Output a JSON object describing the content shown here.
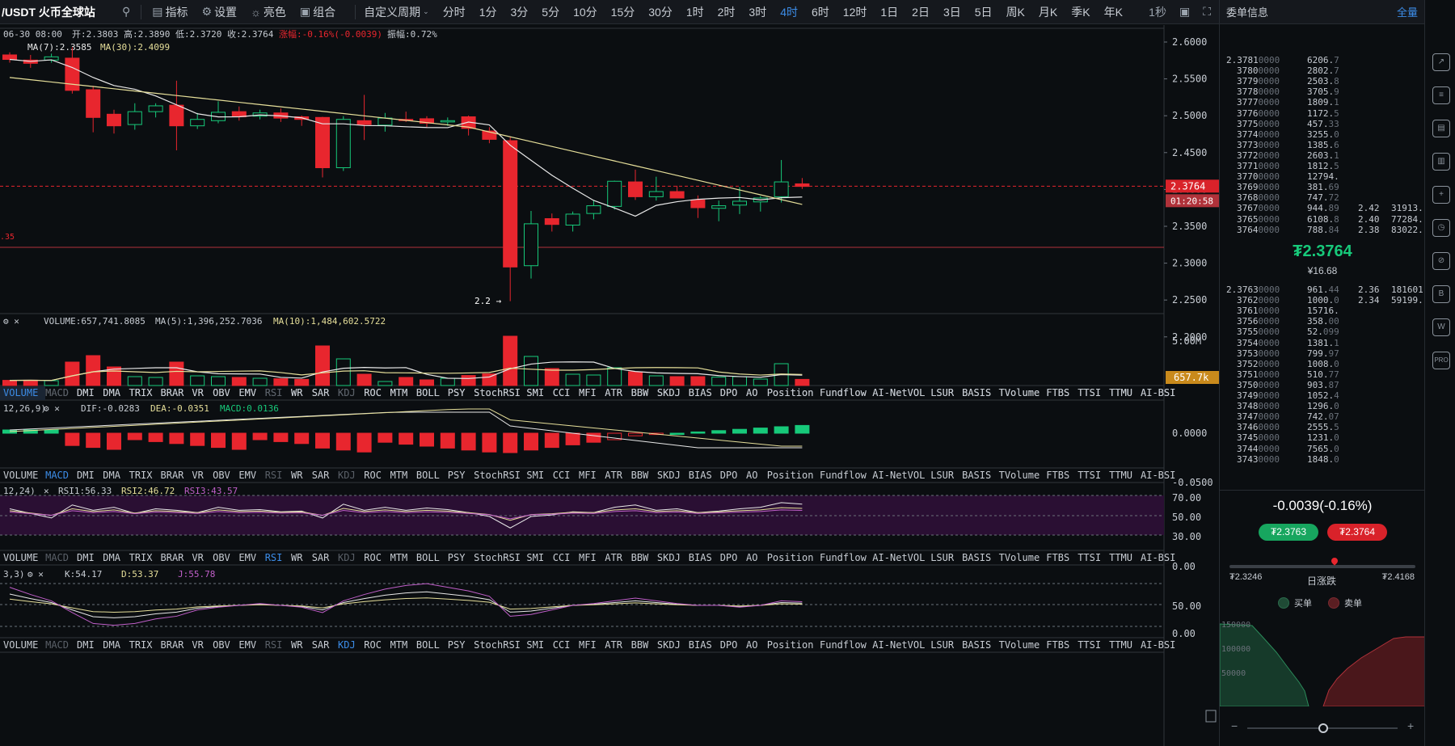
{
  "symbol": "/USDT 火币全球站",
  "toolbar": {
    "search_icon": "search-icon",
    "indicator": "指标",
    "settings": "设置",
    "theme": "亮色",
    "combo": "组合",
    "custom_period": "自定义周期"
  },
  "intervals": [
    "分时",
    "1分",
    "3分",
    "5分",
    "10分",
    "15分",
    "30分",
    "1时",
    "2时",
    "3时",
    "4时",
    "6时",
    "12时",
    "1日",
    "2日",
    "3日",
    "5日",
    "周K",
    "月K",
    "季K",
    "年K"
  ],
  "active_interval": "4时",
  "topbar_right": {
    "refresh": "1秒"
  },
  "info_line": {
    "date": "06-30 08:00",
    "open": "开:2.3803",
    "high": "高:2.3890",
    "low": "低:2.3720",
    "close": "收:2.3764",
    "change": "涨幅:-0.16%(-0.0039)",
    "amplitude": "振幅:0.72%"
  },
  "ma_line": {
    "ma7": "MA(7):2.3585",
    "ma30": "MA(30):2.4099"
  },
  "price_axis": [
    "2.6000",
    "2.5500",
    "2.5000",
    "2.4500",
    "2.4000",
    "2.3500",
    "2.3000",
    "2.2500",
    "2.2000"
  ],
  "last_price_tag": "2.3764",
  "countdown_tag": "01:20:58",
  "left_edge_price": ".35",
  "low_marker": "2.2 →",
  "volume": {
    "header": "VOLUME:657,741.8085",
    "ma5": "MA(5):1,396,252.7036",
    "ma10": "MA(10):1,484,602.5722",
    "axis": "5.00M",
    "tag": "657.7k"
  },
  "macd": {
    "header": "12,26,9)",
    "dif": "DIF:-0.0283",
    "dea": "DEA:-0.0351",
    "macd": "MACD:0.0136",
    "axis": [
      "0.0000",
      "-0.0500"
    ]
  },
  "rsi": {
    "header": "12,24)",
    "rsi1": "RSI1:56.33",
    "rsi2": "RSI2:46.72",
    "rsi3": "RSI3:43.57",
    "axis": [
      "70.00",
      "50.00",
      "30.00",
      "0.00"
    ]
  },
  "kdj": {
    "header": "3,3)",
    "k": "K:54.17",
    "d": "D:53.37",
    "j": "J:55.78",
    "axis": [
      "50.00",
      "0.00"
    ]
  },
  "indicator_tabs": [
    "VOLUME",
    "MACD",
    "DMI",
    "DMA",
    "TRIX",
    "BRAR",
    "VR",
    "OBV",
    "EMV",
    "RSI",
    "WR",
    "SAR",
    "KDJ",
    "ROC",
    "MTM",
    "BOLL",
    "PSY",
    "StochRSI",
    "SMI",
    "CCI",
    "MFI",
    "ATR",
    "BBW",
    "SKDJ",
    "BIAS",
    "DPO",
    "AO",
    "Position",
    "Fundflow",
    "AI-NetVOL",
    "LSUR",
    "BASIS",
    "TVolume",
    "FTBS",
    "TTSI",
    "TTMU",
    "AI-BSI"
  ],
  "orderbook": {
    "title": "委单信息",
    "mode": "全量",
    "asks": [
      [
        "2.3781",
        "0000",
        "6206.",
        "7",
        "",
        ""
      ],
      [
        "3780",
        "0000",
        "2802.",
        "7",
        "",
        ""
      ],
      [
        "3779",
        "0000",
        "2503.",
        "8",
        "",
        ""
      ],
      [
        "3778",
        "0000",
        "3705.",
        "9",
        "",
        ""
      ],
      [
        "3777",
        "0000",
        "1809.",
        "1",
        "",
        ""
      ],
      [
        "3776",
        "0000",
        "1172.",
        "5",
        "",
        ""
      ],
      [
        "3775",
        "0000",
        "457.",
        "33",
        "",
        ""
      ],
      [
        "3774",
        "0000",
        "3255.",
        "0",
        "",
        ""
      ],
      [
        "3773",
        "0000",
        "1385.",
        "6",
        "",
        ""
      ],
      [
        "3772",
        "0000",
        "2603.",
        "1",
        "",
        ""
      ],
      [
        "3771",
        "0000",
        "1812.",
        "5",
        "",
        ""
      ],
      [
        "3770",
        "0000",
        "12794.",
        "",
        "",
        ""
      ],
      [
        "3769",
        "0000",
        "381.",
        "69",
        "",
        ""
      ],
      [
        "3768",
        "0000",
        "747.",
        "72",
        "",
        ""
      ],
      [
        "3767",
        "0000",
        "944.",
        "89",
        "2.42",
        "31913."
      ],
      [
        "3765",
        "0000",
        "6108.",
        "8",
        "2.40",
        "77284."
      ],
      [
        "3764",
        "0000",
        "788.",
        "84",
        "2.38",
        "83022."
      ]
    ],
    "mid_price": "₮2.3764",
    "mid_cny": "¥16.68",
    "bids": [
      [
        "2.3763",
        "0000",
        "961.",
        "44",
        "2.36",
        "181601"
      ],
      [
        "3762",
        "0000",
        "1000.",
        "0",
        "2.34",
        "59199."
      ],
      [
        "3761",
        "0000",
        "15716.",
        "",
        "",
        ""
      ],
      [
        "3756",
        "0000",
        "358.",
        "00",
        "",
        ""
      ],
      [
        "3755",
        "0000",
        "52.",
        "099",
        "",
        ""
      ],
      [
        "3754",
        "0000",
        "1381.",
        "1",
        "",
        ""
      ],
      [
        "3753",
        "0000",
        "799.",
        "97",
        "",
        ""
      ],
      [
        "3752",
        "0000",
        "1008.",
        "0",
        "",
        ""
      ],
      [
        "3751",
        "0000",
        "510.",
        "77",
        "",
        ""
      ],
      [
        "3750",
        "0000",
        "903.",
        "87",
        "",
        ""
      ],
      [
        "3749",
        "0000",
        "1052.",
        "4",
        "",
        ""
      ],
      [
        "3748",
        "0000",
        "1296.",
        "0",
        "",
        ""
      ],
      [
        "3747",
        "0000",
        "742.",
        "07",
        "",
        ""
      ],
      [
        "3746",
        "0000",
        "2555.",
        "5",
        "",
        ""
      ],
      [
        "3745",
        "0000",
        "1231.",
        "0",
        "",
        ""
      ],
      [
        "3744",
        "0000",
        "7565.",
        "0",
        "",
        ""
      ],
      [
        "3743",
        "0000",
        "1848.",
        "0",
        "",
        ""
      ]
    ],
    "change": "-0.0039(-0.16%)",
    "best_bid": "₮2.3763",
    "best_ask": "₮2.3764",
    "range_low": "₮2.3246",
    "range_label": "日涨跌",
    "range_high": "₮2.4168",
    "legend_buy": "买单",
    "legend_sell": "卖单",
    "depth_axis": [
      "150000",
      "100000",
      "50000"
    ],
    "zoom_minus": "−",
    "zoom_plus": "+"
  },
  "rail_icons": [
    "chart-line-icon",
    "document-icon",
    "book-icon",
    "bar-chart-icon",
    "add-icon",
    "clock-icon",
    "compass-icon",
    "letter-b-icon",
    "letter-w-icon",
    "pro-icon"
  ],
  "colors": {
    "up": "#17c97a",
    "down": "#e8262e",
    "ma7": "#e8e8e8",
    "ma30": "#e6df9a",
    "accent": "#3c8ce7"
  },
  "candles": [
    [
      2.58,
      2.584,
      2.568,
      2.573
    ],
    [
      2.572,
      2.58,
      2.56,
      2.567
    ],
    [
      2.572,
      2.582,
      2.568,
      2.577
    ],
    [
      2.575,
      2.592,
      2.52,
      2.525
    ],
    [
      2.526,
      2.532,
      2.46,
      2.483
    ],
    [
      2.488,
      2.495,
      2.458,
      2.47
    ],
    [
      2.472,
      2.505,
      2.464,
      2.492
    ],
    [
      2.492,
      2.505,
      2.483,
      2.501
    ],
    [
      2.502,
      2.54,
      2.432,
      2.47
    ],
    [
      2.47,
      2.49,
      2.465,
      2.48
    ],
    [
      2.478,
      2.508,
      2.474,
      2.491
    ],
    [
      2.492,
      2.5,
      2.478,
      2.484
    ],
    [
      2.485,
      2.495,
      2.48,
      2.49
    ],
    [
      2.49,
      2.497,
      2.476,
      2.482
    ],
    [
      2.484,
      2.486,
      2.47,
      2.48
    ],
    [
      2.483,
      2.484,
      2.39,
      2.405
    ],
    [
      2.405,
      2.485,
      2.4,
      2.48
    ],
    [
      2.478,
      2.518,
      2.448,
      2.472
    ],
    [
      2.471,
      2.49,
      2.461,
      2.482
    ],
    [
      2.48,
      2.492,
      2.476,
      2.479
    ],
    [
      2.481,
      2.485,
      2.468,
      2.474
    ],
    [
      2.476,
      2.483,
      2.47,
      2.478
    ],
    [
      2.484,
      2.486,
      2.455,
      2.466
    ],
    [
      2.462,
      2.468,
      2.443,
      2.449
    ],
    [
      2.447,
      2.452,
      2.198,
      2.251
    ],
    [
      2.253,
      2.338,
      2.233,
      2.318
    ],
    [
      2.326,
      2.334,
      2.306,
      2.317
    ],
    [
      2.316,
      2.337,
      2.306,
      2.333
    ],
    [
      2.334,
      2.355,
      2.325,
      2.346
    ],
    [
      2.345,
      2.385,
      2.34,
      2.384
    ],
    [
      2.383,
      2.402,
      2.355,
      2.36
    ],
    [
      2.36,
      2.391,
      2.354,
      2.368
    ],
    [
      2.368,
      2.377,
      2.358,
      2.358
    ],
    [
      2.355,
      2.362,
      2.327,
      2.343
    ],
    [
      2.342,
      2.354,
      2.322,
      2.346
    ],
    [
      2.347,
      2.375,
      2.333,
      2.353
    ],
    [
      2.352,
      2.361,
      2.337,
      2.358
    ],
    [
      2.36,
      2.417,
      2.351,
      2.383
    ],
    [
      2.38,
      2.389,
      2.372,
      2.376
    ]
  ],
  "volumes": [
    0.32,
    0.33,
    0.3,
    1.45,
    1.85,
    1.15,
    0.55,
    0.5,
    1.45,
    0.6,
    0.55,
    0.5,
    0.45,
    0.42,
    0.38,
    2.45,
    1.65,
    0.7,
    0.25,
    0.5,
    0.35,
    0.45,
    0.62,
    0.72,
    3.05,
    1.8,
    1.05,
    0.7,
    0.65,
    1.1,
    0.85,
    0.6,
    0.55,
    0.55,
    0.52,
    0.55,
    0.4,
    1.35,
    0.38
  ]
}
